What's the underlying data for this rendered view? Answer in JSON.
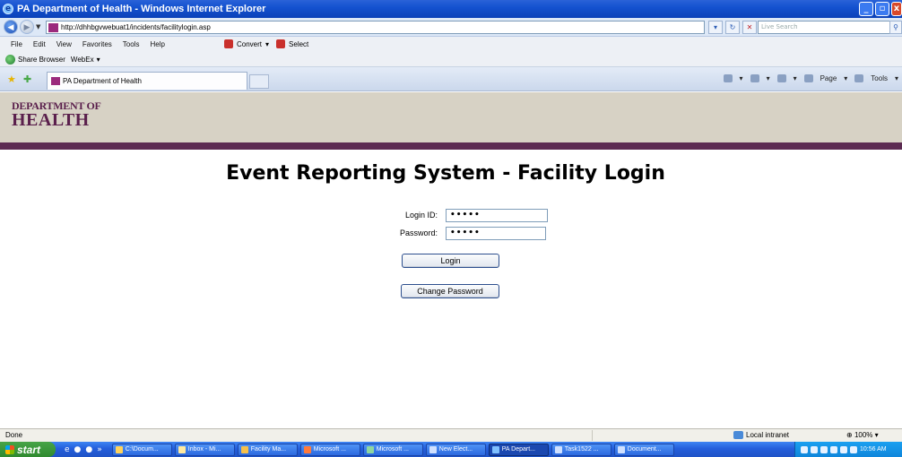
{
  "window": {
    "title": "PA Department of Health - Windows Internet Explorer"
  },
  "address_bar": {
    "url": "http://dhhbgvwebuat1/incidents/facilitylogin.asp",
    "search_placeholder": "Live Search"
  },
  "menu": {
    "items": [
      "File",
      "Edit",
      "View",
      "Favorites",
      "Tools",
      "Help"
    ],
    "convert_label": "Convert",
    "select_label": "Select"
  },
  "links_bar": {
    "share_browser": "Share Browser",
    "webex": "WebEx"
  },
  "tab": {
    "label": "PA Department of Health"
  },
  "command_bar": {
    "page": "Page",
    "tools": "Tools"
  },
  "page": {
    "logo_line1": "DEPARTMENT OF",
    "logo_line2": "HEALTH",
    "title": "Event Reporting System - Facility Login",
    "login_id_label": "Login ID:",
    "login_id_value": "•••••",
    "password_label": "Password:",
    "password_value": "•••••",
    "login_button": "Login",
    "change_password_button": "Change Password"
  },
  "status_bar": {
    "status": "Done",
    "zone": "Local intranet",
    "zoom": "100%"
  },
  "taskbar": {
    "start": "start",
    "tasks": [
      "C:\\Docum...",
      "Inbox - Mi...",
      "Facility Ma...",
      "Microsoft ...",
      "Microsoft ...",
      "New Elect...",
      "PA Depart...",
      "Task1522 ...",
      "Document..."
    ],
    "clock": "10:56 AM"
  }
}
